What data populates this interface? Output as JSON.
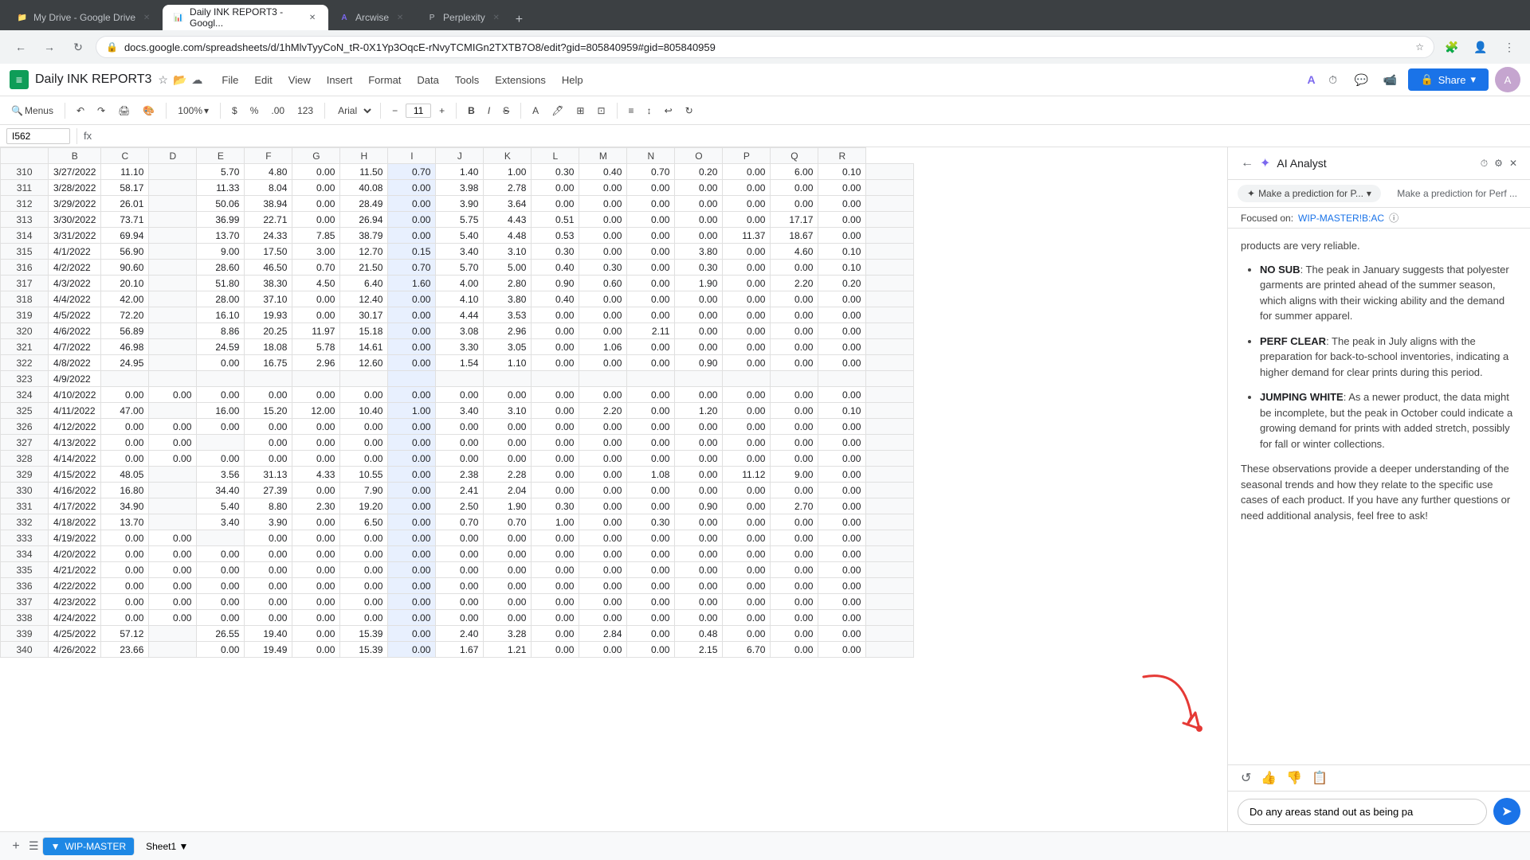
{
  "browser": {
    "tabs": [
      {
        "id": "gdrive",
        "label": "My Drive - Google Drive",
        "active": false,
        "favicon": "📁"
      },
      {
        "id": "sheets",
        "label": "Daily INK REPORT3 - Googl...",
        "active": true,
        "favicon": "📊"
      },
      {
        "id": "arcwise",
        "label": "Arcwise",
        "active": false,
        "favicon": "A"
      },
      {
        "id": "perplexity",
        "label": "Perplexity",
        "active": false,
        "favicon": "P"
      }
    ],
    "url": "docs.google.com/spreadsheets/d/1hMlvTyyCoN_tR-0X1Yp3OqcE-rNvyTCMIGn2TXTB7O8/edit?gid=805840959#gid=805840959"
  },
  "app": {
    "title": "Daily INK REPORT3",
    "menu": [
      "File",
      "Edit",
      "View",
      "Insert",
      "Format",
      "Data",
      "Tools",
      "Extensions",
      "Help"
    ],
    "cell_ref": "I562",
    "zoom": "100%",
    "font": "Arial",
    "font_size": "11",
    "sheet_tabs": [
      "WIP-MASTER",
      "Sheet1"
    ]
  },
  "columns": [
    "",
    "B",
    "C",
    "D",
    "E",
    "F",
    "G",
    "H",
    "I",
    "J",
    "K",
    "L",
    "M",
    "N",
    "O",
    "P",
    "Q",
    "R"
  ],
  "rows": [
    {
      "num": 310,
      "data": [
        "3/27/2022",
        "11.10",
        "",
        "5.70",
        "4.80",
        "0.00",
        "11.50",
        "0.70",
        "1.40",
        "1.00",
        "0.30",
        "0.40",
        "0.70",
        "0.20",
        "0.00",
        "6.00",
        "0.10",
        ""
      ]
    },
    {
      "num": 311,
      "data": [
        "3/28/2022",
        "58.17",
        "",
        "11.33",
        "8.04",
        "0.00",
        "40.08",
        "0.00",
        "3.98",
        "2.78",
        "0.00",
        "0.00",
        "0.00",
        "0.00",
        "0.00",
        "0.00",
        "0.00",
        ""
      ]
    },
    {
      "num": 312,
      "data": [
        "3/29/2022",
        "26.01",
        "",
        "50.06",
        "38.94",
        "0.00",
        "28.49",
        "0.00",
        "3.90",
        "3.64",
        "0.00",
        "0.00",
        "0.00",
        "0.00",
        "0.00",
        "0.00",
        "0.00",
        ""
      ]
    },
    {
      "num": 313,
      "data": [
        "3/30/2022",
        "73.71",
        "",
        "36.99",
        "22.71",
        "0.00",
        "26.94",
        "0.00",
        "5.75",
        "4.43",
        "0.51",
        "0.00",
        "0.00",
        "0.00",
        "0.00",
        "17.17",
        "0.00",
        ""
      ]
    },
    {
      "num": 314,
      "data": [
        "3/31/2022",
        "69.94",
        "",
        "13.70",
        "24.33",
        "7.85",
        "38.79",
        "0.00",
        "5.40",
        "4.48",
        "0.53",
        "0.00",
        "0.00",
        "0.00",
        "11.37",
        "18.67",
        "0.00",
        ""
      ]
    },
    {
      "num": 315,
      "data": [
        "4/1/2022",
        "56.90",
        "",
        "9.00",
        "17.50",
        "3.00",
        "12.70",
        "0.15",
        "3.40",
        "3.10",
        "0.30",
        "0.00",
        "0.00",
        "3.80",
        "0.00",
        "4.60",
        "0.10",
        ""
      ]
    },
    {
      "num": 316,
      "data": [
        "4/2/2022",
        "90.60",
        "",
        "28.60",
        "46.50",
        "0.70",
        "21.50",
        "0.70",
        "5.70",
        "5.00",
        "0.40",
        "0.30",
        "0.00",
        "0.30",
        "0.00",
        "0.00",
        "0.10",
        ""
      ]
    },
    {
      "num": 317,
      "data": [
        "4/3/2022",
        "20.10",
        "",
        "51.80",
        "38.30",
        "4.50",
        "6.40",
        "1.60",
        "4.00",
        "2.80",
        "0.90",
        "0.60",
        "0.00",
        "1.90",
        "0.00",
        "2.20",
        "0.20",
        ""
      ]
    },
    {
      "num": 318,
      "data": [
        "4/4/2022",
        "42.00",
        "",
        "28.00",
        "37.10",
        "0.00",
        "12.40",
        "0.00",
        "4.10",
        "3.80",
        "0.40",
        "0.00",
        "0.00",
        "0.00",
        "0.00",
        "0.00",
        "0.00",
        ""
      ]
    },
    {
      "num": 319,
      "data": [
        "4/5/2022",
        "72.20",
        "",
        "16.10",
        "19.93",
        "0.00",
        "30.17",
        "0.00",
        "4.44",
        "3.53",
        "0.00",
        "0.00",
        "0.00",
        "0.00",
        "0.00",
        "0.00",
        "0.00",
        ""
      ]
    },
    {
      "num": 320,
      "data": [
        "4/6/2022",
        "56.89",
        "",
        "8.86",
        "20.25",
        "11.97",
        "15.18",
        "0.00",
        "3.08",
        "2.96",
        "0.00",
        "0.00",
        "2.11",
        "0.00",
        "0.00",
        "0.00",
        "0.00",
        ""
      ]
    },
    {
      "num": 321,
      "data": [
        "4/7/2022",
        "46.98",
        "",
        "24.59",
        "18.08",
        "5.78",
        "14.61",
        "0.00",
        "3.30",
        "3.05",
        "0.00",
        "1.06",
        "0.00",
        "0.00",
        "0.00",
        "0.00",
        "0.00",
        ""
      ]
    },
    {
      "num": 322,
      "data": [
        "4/8/2022",
        "24.95",
        "",
        "0.00",
        "16.75",
        "2.96",
        "12.60",
        "0.00",
        "1.54",
        "1.10",
        "0.00",
        "0.00",
        "0.00",
        "0.90",
        "0.00",
        "0.00",
        "0.00",
        ""
      ]
    },
    {
      "num": 323,
      "data": [
        "4/9/2022",
        "",
        "",
        "",
        "",
        "",
        "",
        "",
        "",
        "",
        "",
        "",
        "",
        "",
        "",
        "",
        "",
        ""
      ]
    },
    {
      "num": 324,
      "data": [
        "4/10/2022",
        "0.00",
        "0.00",
        "0.00",
        "0.00",
        "0.00",
        "0.00",
        "0.00",
        "0.00",
        "0.00",
        "0.00",
        "0.00",
        "0.00",
        "0.00",
        "0.00",
        "0.00",
        "0.00",
        ""
      ]
    },
    {
      "num": 325,
      "data": [
        "4/11/2022",
        "47.00",
        "",
        "16.00",
        "15.20",
        "12.00",
        "10.40",
        "1.00",
        "3.40",
        "3.10",
        "0.00",
        "2.20",
        "0.00",
        "1.20",
        "0.00",
        "0.00",
        "0.10",
        ""
      ]
    },
    {
      "num": 326,
      "data": [
        "4/12/2022",
        "0.00",
        "0.00",
        "0.00",
        "0.00",
        "0.00",
        "0.00",
        "0.00",
        "0.00",
        "0.00",
        "0.00",
        "0.00",
        "0.00",
        "0.00",
        "0.00",
        "0.00",
        "0.00",
        ""
      ]
    },
    {
      "num": 327,
      "data": [
        "4/13/2022",
        "0.00",
        "0.00",
        "",
        "0.00",
        "0.00",
        "0.00",
        "0.00",
        "0.00",
        "0.00",
        "0.00",
        "0.00",
        "0.00",
        "0.00",
        "0.00",
        "0.00",
        "0.00",
        ""
      ]
    },
    {
      "num": 328,
      "data": [
        "4/14/2022",
        "0.00",
        "0.00",
        "0.00",
        "0.00",
        "0.00",
        "0.00",
        "0.00",
        "0.00",
        "0.00",
        "0.00",
        "0.00",
        "0.00",
        "0.00",
        "0.00",
        "0.00",
        "0.00",
        ""
      ]
    },
    {
      "num": 329,
      "data": [
        "4/15/2022",
        "48.05",
        "",
        "3.56",
        "31.13",
        "4.33",
        "10.55",
        "0.00",
        "2.38",
        "2.28",
        "0.00",
        "0.00",
        "1.08",
        "0.00",
        "11.12",
        "9.00",
        "0.00",
        ""
      ]
    },
    {
      "num": 330,
      "data": [
        "4/16/2022",
        "16.80",
        "",
        "34.40",
        "27.39",
        "0.00",
        "7.90",
        "0.00",
        "2.41",
        "2.04",
        "0.00",
        "0.00",
        "0.00",
        "0.00",
        "0.00",
        "0.00",
        "0.00",
        ""
      ]
    },
    {
      "num": 331,
      "data": [
        "4/17/2022",
        "34.90",
        "",
        "5.40",
        "8.80",
        "2.30",
        "19.20",
        "0.00",
        "2.50",
        "1.90",
        "0.30",
        "0.00",
        "0.00",
        "0.90",
        "0.00",
        "2.70",
        "0.00",
        ""
      ]
    },
    {
      "num": 332,
      "data": [
        "4/18/2022",
        "13.70",
        "",
        "3.40",
        "3.90",
        "0.00",
        "6.50",
        "0.00",
        "0.70",
        "0.70",
        "1.00",
        "0.00",
        "0.30",
        "0.00",
        "0.00",
        "0.00",
        "0.00",
        ""
      ]
    },
    {
      "num": 333,
      "data": [
        "4/19/2022",
        "0.00",
        "0.00",
        "",
        "0.00",
        "0.00",
        "0.00",
        "0.00",
        "0.00",
        "0.00",
        "0.00",
        "0.00",
        "0.00",
        "0.00",
        "0.00",
        "0.00",
        "0.00",
        ""
      ]
    },
    {
      "num": 334,
      "data": [
        "4/20/2022",
        "0.00",
        "0.00",
        "0.00",
        "0.00",
        "0.00",
        "0.00",
        "0.00",
        "0.00",
        "0.00",
        "0.00",
        "0.00",
        "0.00",
        "0.00",
        "0.00",
        "0.00",
        "0.00",
        ""
      ]
    },
    {
      "num": 335,
      "data": [
        "4/21/2022",
        "0.00",
        "0.00",
        "0.00",
        "0.00",
        "0.00",
        "0.00",
        "0.00",
        "0.00",
        "0.00",
        "0.00",
        "0.00",
        "0.00",
        "0.00",
        "0.00",
        "0.00",
        "0.00",
        ""
      ]
    },
    {
      "num": 336,
      "data": [
        "4/22/2022",
        "0.00",
        "0.00",
        "0.00",
        "0.00",
        "0.00",
        "0.00",
        "0.00",
        "0.00",
        "0.00",
        "0.00",
        "0.00",
        "0.00",
        "0.00",
        "0.00",
        "0.00",
        "0.00",
        ""
      ]
    },
    {
      "num": 337,
      "data": [
        "4/23/2022",
        "0.00",
        "0.00",
        "0.00",
        "0.00",
        "0.00",
        "0.00",
        "0.00",
        "0.00",
        "0.00",
        "0.00",
        "0.00",
        "0.00",
        "0.00",
        "0.00",
        "0.00",
        "0.00",
        ""
      ]
    },
    {
      "num": 338,
      "data": [
        "4/24/2022",
        "0.00",
        "0.00",
        "0.00",
        "0.00",
        "0.00",
        "0.00",
        "0.00",
        "0.00",
        "0.00",
        "0.00",
        "0.00",
        "0.00",
        "0.00",
        "0.00",
        "0.00",
        "0.00",
        ""
      ]
    },
    {
      "num": 339,
      "data": [
        "4/25/2022",
        "57.12",
        "",
        "26.55",
        "19.40",
        "0.00",
        "15.39",
        "0.00",
        "2.40",
        "3.28",
        "0.00",
        "2.84",
        "0.00",
        "0.48",
        "0.00",
        "0.00",
        "0.00",
        ""
      ]
    },
    {
      "num": 340,
      "data": [
        "4/26/2022",
        "23.66",
        "",
        "0.00",
        "19.49",
        "0.00",
        "15.39",
        "0.00",
        "1.67",
        "1.21",
        "0.00",
        "0.00",
        "0.00",
        "2.15",
        "6.70",
        "0.00",
        "0.00",
        ""
      ]
    }
  ],
  "ai_panel": {
    "title": "AI Analyst",
    "prediction_btn": "Make a prediction for P...",
    "prediction_btn2": "Make a prediction for Perf ...",
    "focused_on_label": "Focused on:",
    "focused_on_value": "WIP-MASTER!B:AC",
    "content_intro": "products are very reliable.",
    "bullets": [
      {
        "title": "NO SUB",
        "text": ": The peak in January suggests that polyester garments are printed ahead of the summer season, which aligns with their wicking ability and the demand for summer apparel."
      },
      {
        "title": "PERF CLEAR",
        "text": ": The peak in July aligns with the preparation for back-to-school inventories, indicating a higher demand for clear prints during this period."
      },
      {
        "title": "JUMPING WHITE",
        "text": ": As a newer product, the data might be incomplete, but the peak in October could indicate a growing demand for prints with added stretch, possibly for fall or winter collections."
      }
    ],
    "closing_text": "These observations provide a deeper understanding of the seasonal trends and how they relate to the specific use cases of each product. If you have any further questions or need additional analysis, feel free to ask!",
    "input_placeholder": "Do any areas stand out as being pa",
    "input_value": "Do any areas stand out as being pa"
  }
}
